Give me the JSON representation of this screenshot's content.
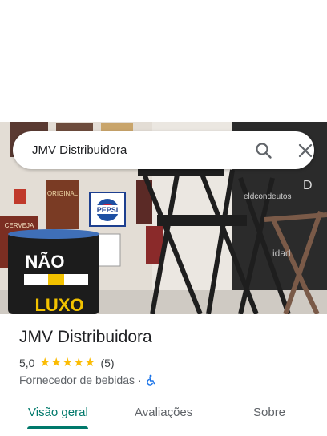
{
  "search": {
    "query": "JMV Distribuidora",
    "search_icon": "search-icon",
    "close_icon": "close-icon"
  },
  "photo": {
    "barrel_top_text": "NÃO",
    "barrel_bottom_text": "LUXO",
    "sign_pepsi": "PEPSI",
    "sign_original": "ORIGINAL",
    "sign_cerveja": "CERVEJA",
    "shelf_letter": "D",
    "shelf_text": "eldcondeutos",
    "shelf_text2": "idad"
  },
  "place": {
    "title": "JMV Distribuidora",
    "rating": "5,0",
    "stars": 5,
    "review_count": "(5)",
    "category": "Fornecedor de bebidas",
    "separator": "·",
    "accessibility_icon": "wheelchair-icon"
  },
  "tabs": [
    {
      "label": "Visão geral",
      "active": true
    },
    {
      "label": "Avaliações",
      "active": false
    },
    {
      "label": "Sobre",
      "active": false
    }
  ],
  "colors": {
    "accent": "#00796b",
    "star": "#fbbc04",
    "wheelchair": "#1a73e8"
  }
}
